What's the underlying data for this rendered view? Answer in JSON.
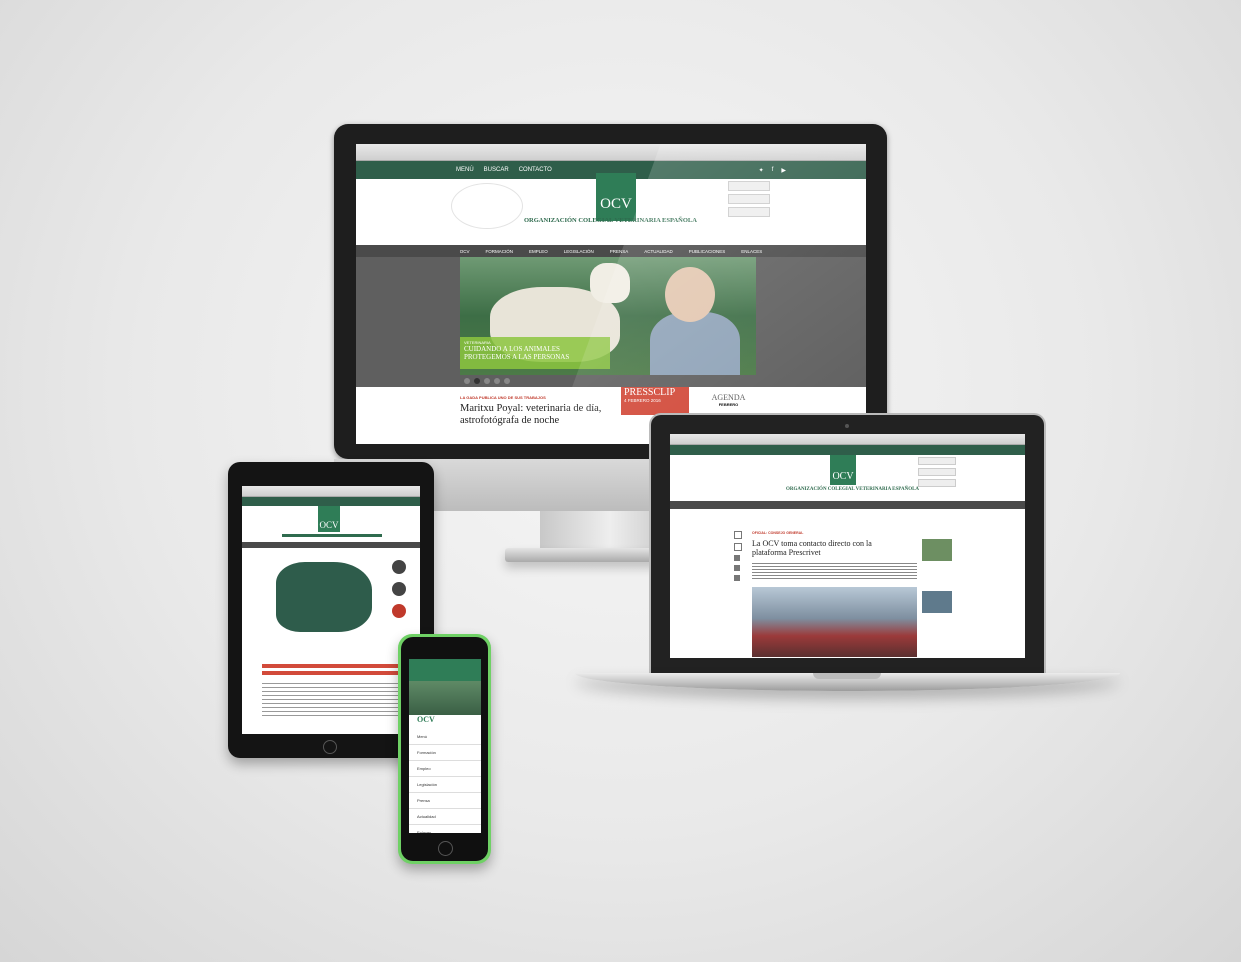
{
  "desktop": {
    "topbar": {
      "menu": "MENÚ",
      "search": "BUSCAR",
      "contact": "CONTACTO"
    },
    "logo": "OCV",
    "org_name": "ORGANIZACIÓN COLEGIAL VETERINARIA ESPAÑOLA",
    "nav": [
      "OCV",
      "FORMACIÓN",
      "EMPLEO",
      "LEGISLACIÓN",
      "PRENSA",
      "ACTUALIDAD",
      "PUBLICACIONES",
      "ENLACES"
    ],
    "hero": {
      "category": "VETERINARIA",
      "title_line1": "CUIDANDO A LOS ANIMALES",
      "title_line2": "PROTEGEMOS A LAS PERSONAS"
    },
    "article": {
      "kicker": "LA GADA PUBLICA UNO DE SUS TRABAJOS",
      "title_line1": "Maritxu Poyal: veterinaria de día,",
      "title_line2": "astrofotógrafa de noche"
    },
    "pressclip": {
      "title": "PRESSCLIP",
      "date": "4 FEBRERO 2016"
    },
    "agenda": {
      "title": "AGENDA",
      "month": "FEBRERO"
    }
  },
  "laptop": {
    "logo": "OCV",
    "org_name": "ORGANIZACIÓN COLEGIAL VETERINARIA ESPAÑOLA",
    "article": {
      "kicker": "OFICIAL: CONSEJO GENERAL",
      "title_line1": "La OCV toma contacto directo con la",
      "title_line2": "plataforma Prescrivet"
    }
  },
  "tablet": {
    "logo": "OCV"
  },
  "phone": {
    "logo": "OCV",
    "menu": [
      "Menú",
      "Formación",
      "Empleo",
      "Legislación",
      "Prensa",
      "Actualidad",
      "Enlaces"
    ]
  },
  "colors": {
    "brand_green": "#2f7d57",
    "accent_red": "#c0392b",
    "lime": "#8cc63f",
    "phone_body": "#6fd165"
  }
}
